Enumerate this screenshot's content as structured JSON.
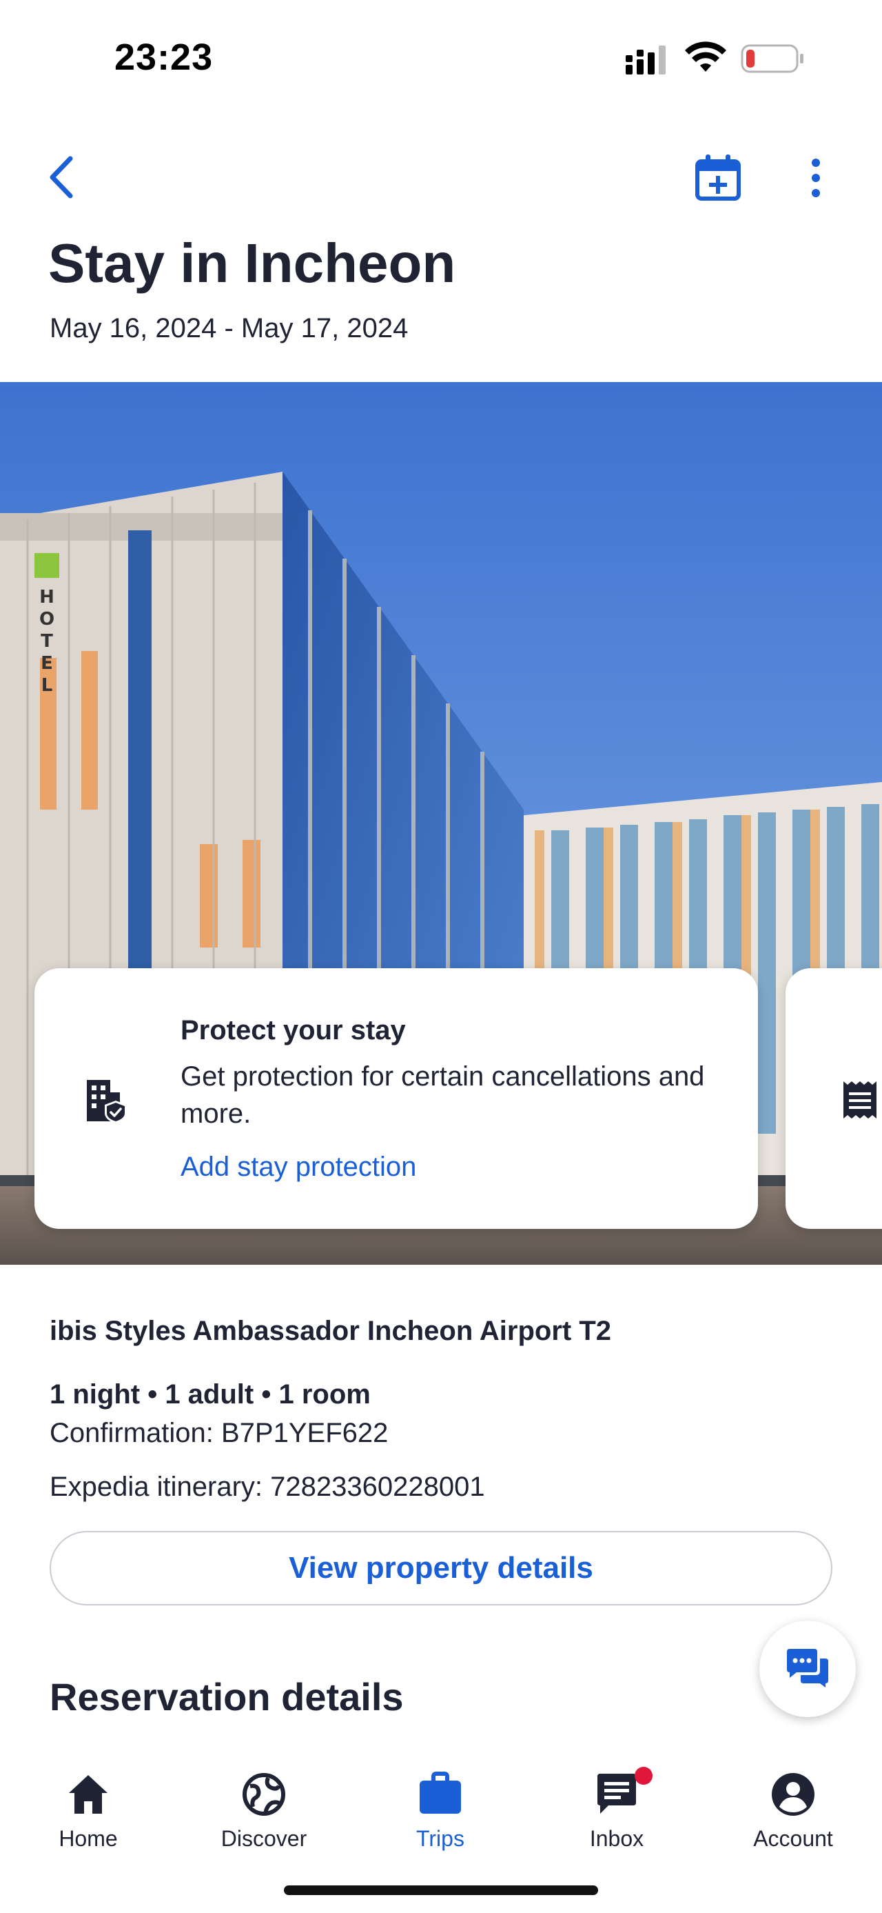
{
  "status_bar": {
    "time": "23:23",
    "icons": [
      "cellular-signal-icon",
      "wifi-icon",
      "battery-low-icon"
    ],
    "battery_color": "#e23b3b"
  },
  "header": {
    "back_icon": "chevron-left-icon",
    "actions": [
      "calendar-add-icon",
      "more-vertical-icon"
    ],
    "title": "Stay in Incheon",
    "dates": "May 16, 2024 - May 17, 2024"
  },
  "hero": {
    "image": "hotel-building-photo",
    "sign_text": "HOTEL"
  },
  "protect_card": {
    "icon": "building-shield-icon",
    "title": "Protect your stay",
    "body": "Get protection for certain cancellations and more.",
    "link": "Add stay protection"
  },
  "next_card": {
    "icon": "receipt-icon"
  },
  "booking": {
    "hotel_name": "ibis Styles Ambassador Incheon Airport T2",
    "summary": "1 night • 1 adult • 1 room",
    "confirmation": "Confirmation: B7P1YEF622",
    "itinerary": "Expedia itinerary: 72823360228001",
    "view_details": "View property details"
  },
  "reservation": {
    "title": "Reservation details"
  },
  "chat": {
    "icon": "chat-bubbles-icon"
  },
  "nav": {
    "items": [
      {
        "label": "Home",
        "icon": "home-icon",
        "active": false
      },
      {
        "label": "Discover",
        "icon": "globe-icon",
        "active": false
      },
      {
        "label": "Trips",
        "icon": "briefcase-icon",
        "active": true
      },
      {
        "label": "Inbox",
        "icon": "inbox-icon",
        "active": false,
        "badge": true
      },
      {
        "label": "Account",
        "icon": "account-icon",
        "active": false
      }
    ]
  },
  "colors": {
    "brand_blue": "#1a5fd6",
    "text_dark": "#1f2333",
    "badge_red": "#e0163b"
  }
}
